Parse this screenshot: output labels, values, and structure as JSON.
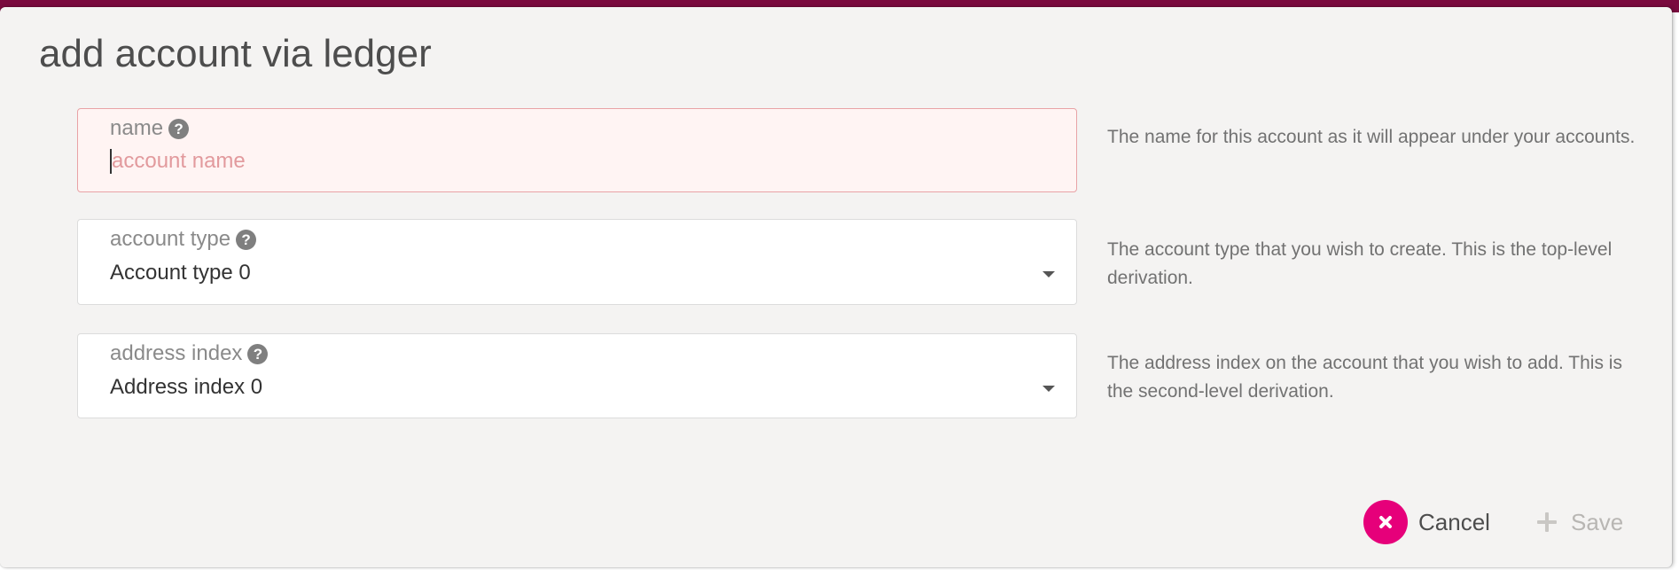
{
  "modal": {
    "title": "add account via ledger",
    "fields": {
      "name": {
        "label": "name",
        "placeholder": "account name",
        "value": "",
        "help": "The name for this account as it will appear under your accounts."
      },
      "account_type": {
        "label": "account type",
        "value": "Account type 0",
        "help": "The account type that you wish to create. This is the top-level derivation."
      },
      "address_index": {
        "label": "address index",
        "value": "Address index 0",
        "help": "The address index on the account that you wish to add. This is the second-level derivation."
      }
    },
    "buttons": {
      "cancel": "Cancel",
      "save": "Save"
    }
  },
  "colors": {
    "accent": "#e6007a",
    "header_bar": "#7a0a3e",
    "invalid_bg": "#fff4f3",
    "invalid_border": "#e8a3a6"
  },
  "icons": {
    "help": "help-circle-icon",
    "dropdown": "chevron-down-icon",
    "cancel": "close-icon",
    "save": "plus-icon"
  }
}
